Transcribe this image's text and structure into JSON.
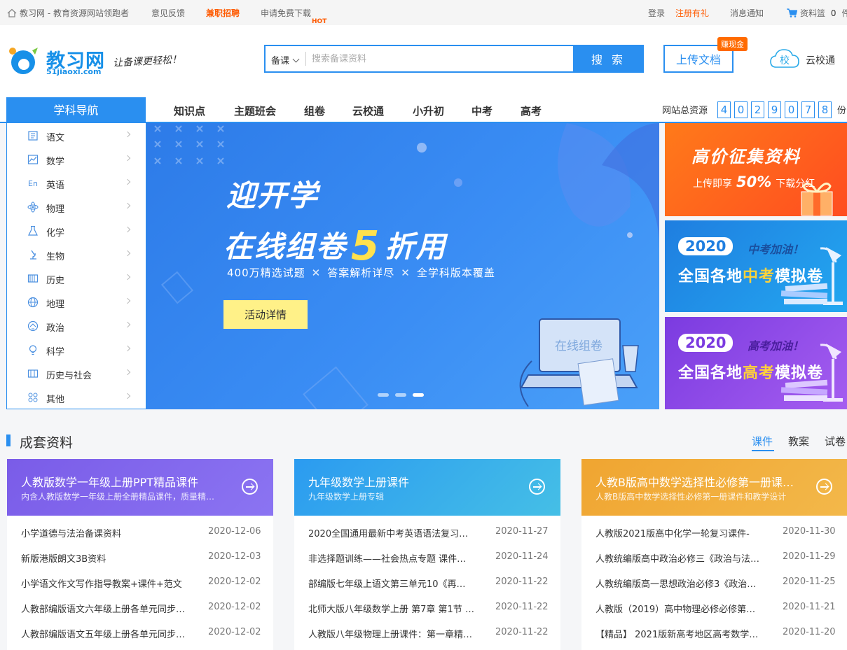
{
  "topbar": {
    "site_title": "教习网 - 教育资源网站领跑者",
    "feedback": "意见反馈",
    "jobs": "兼职招聘",
    "free_download": "申请免费下载",
    "hot_badge": "HOT",
    "login": "登录",
    "register": "注册有礼",
    "messages": "消息通知",
    "basket": "资料篮",
    "basket_count": "0",
    "basket_unit": "件"
  },
  "logo": {
    "name": "教习网",
    "domain": "51jiaoxi.com",
    "slogan": "让备课更轻松！"
  },
  "search": {
    "type": "备课",
    "placeholder": "搜索备课资料",
    "button": "搜 索"
  },
  "upload": {
    "button": "上传文档",
    "badge": "赚现金"
  },
  "cloud": {
    "icon_text": "校",
    "label": "云校通"
  },
  "nav": {
    "subject_nav": "学科导航",
    "links": [
      "知识点",
      "主题班会",
      "组卷",
      "云校通",
      "小升初",
      "中考",
      "高考"
    ],
    "total_label": "网站总资源",
    "total_digits": [
      "4",
      "0",
      "2",
      "9",
      "0",
      "7",
      "8"
    ],
    "total_unit": "份"
  },
  "subjects": [
    {
      "label": "语文",
      "icon": "book-icon"
    },
    {
      "label": "数学",
      "icon": "chart-icon"
    },
    {
      "label": "英语",
      "icon": "english-icon"
    },
    {
      "label": "物理",
      "icon": "atom-icon"
    },
    {
      "label": "化学",
      "icon": "flask-icon"
    },
    {
      "label": "生物",
      "icon": "microscope-icon"
    },
    {
      "label": "历史",
      "icon": "scroll-icon"
    },
    {
      "label": "地理",
      "icon": "globe-icon"
    },
    {
      "label": "政治",
      "icon": "politics-icon"
    },
    {
      "label": "科学",
      "icon": "bulb-icon"
    },
    {
      "label": "历史与社会",
      "icon": "history-society-icon"
    },
    {
      "label": "其他",
      "icon": "grid-icon"
    }
  ],
  "banner": {
    "title1": "迎开学",
    "title2_a": "在线组卷",
    "title2_num": "5",
    "title2_b": "折用",
    "sub1": "400万精选试题",
    "sub2": "答案解析详尽",
    "sub3": "全学科版本覆盖",
    "button": "活动详情",
    "laptop_label": "在线组卷"
  },
  "ads": {
    "ad1_title": "高价征集资料",
    "ad1_sub_a": "上传即享",
    "ad1_pct": "50%",
    "ad1_sub_b": "下载分红",
    "ad2_year": "2020",
    "ad2_cheer": "中考加油！",
    "ad2_line_a": "全国各地",
    "ad2_line_hl": "中考",
    "ad2_line_b": "模拟卷",
    "ad3_year": "2020",
    "ad3_cheer": "高考加油！",
    "ad3_line_a": "全国各地",
    "ad3_line_hl": "高考",
    "ad3_line_b": "模拟卷"
  },
  "section": {
    "title": "成套资料",
    "tabs": [
      "课件",
      "教案",
      "试卷"
    ]
  },
  "cards": [
    {
      "title": "人教版数学一年级上册PPT精品课件",
      "desc": "内含人教版数学一年级上册全册精品课件，质量精…",
      "rows": [
        {
          "t": "小学道德与法治备课资料",
          "d": "2020-12-06"
        },
        {
          "t": "新版港版朗文3B资料",
          "d": "2020-12-03"
        },
        {
          "t": "小学语文作文写作指导教案+课件+范文",
          "d": "2020-12-02"
        },
        {
          "t": "人教部编版语文六年级上册各单元同步…",
          "d": "2020-12-02"
        },
        {
          "t": "人教部编版语文五年级上册各单元同步…",
          "d": "2020-12-02"
        }
      ]
    },
    {
      "title": "九年级数学上册课件",
      "desc": "九年级数学上册专辑",
      "rows": [
        {
          "t": "2020全国通用最新中考英语语法复习…",
          "d": "2020-11-27"
        },
        {
          "t": "非选择题训练——社会热点专题 课件…",
          "d": "2020-11-24"
        },
        {
          "t": "部编版七年级上语文第三单元10《再…",
          "d": "2020-11-22"
        },
        {
          "t": "北师大版八年级数学上册 第7章 第1节 …",
          "d": "2020-11-22"
        },
        {
          "t": "人教版八年级物理上册课件：第一章精…",
          "d": "2020-11-22"
        }
      ]
    },
    {
      "title": "人教B版高中数学选择性必修第一册课…",
      "desc": "人教B版高中数学选择性必修第一册课件和教学设计",
      "rows": [
        {
          "t": "人教版2021版高中化学一轮复习课件-",
          "d": "2020-11-30"
        },
        {
          "t": "人教统编版高中政治必修三《政治与法…",
          "d": "2020-11-29"
        },
        {
          "t": "人教统编版高一思想政治必修3《政治…",
          "d": "2020-11-25"
        },
        {
          "t": "人教版（2019）高中物理必修必修第…",
          "d": "2020-11-21"
        },
        {
          "t": "【精品】 2021版新高考地区高考数学…",
          "d": "2020-11-20"
        }
      ]
    }
  ],
  "colors": {
    "brand": "#2a8ff0",
    "orange": "#ff6a00",
    "banner_yellow": "#ffe14d"
  }
}
